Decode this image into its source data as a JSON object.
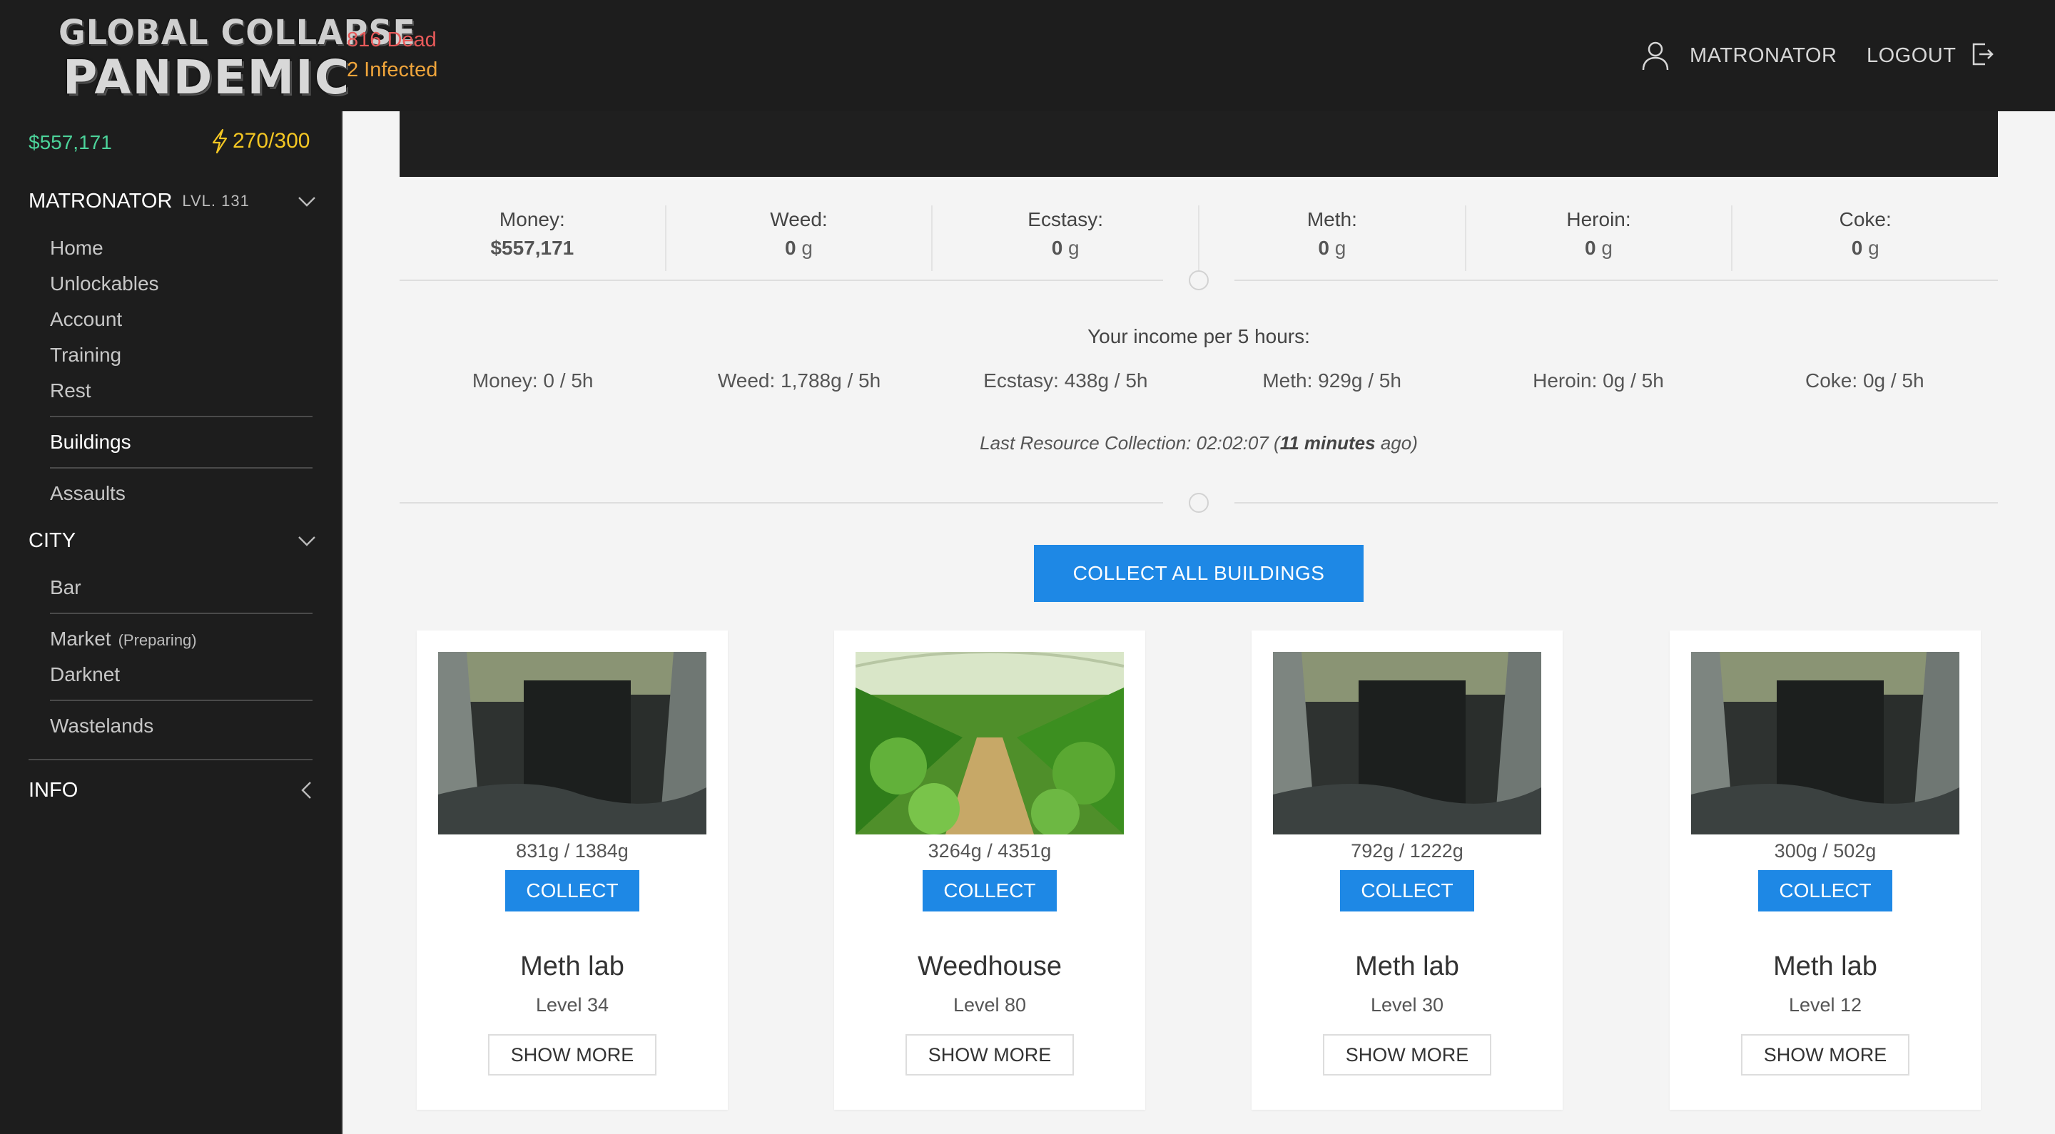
{
  "header": {
    "logo_line1": "GLOBAL COLLAPSE",
    "logo_line2": "PANDEMIC",
    "dead": "816 Dead",
    "infected": "2 Infected",
    "username": "MATRONATOR",
    "logout": "LOGOUT",
    "icons": {
      "user": "user-icon",
      "logout": "logout-icon"
    }
  },
  "sidebar": {
    "money": "$557,171",
    "energy": "270/300",
    "player_section": {
      "name": "MATRONATOR",
      "level": "LVL. 131"
    },
    "player_items": [
      "Home",
      "Unlockables",
      "Account",
      "Training",
      "Rest",
      "Buildings",
      "Assaults"
    ],
    "active_item": "Buildings",
    "city_section": {
      "label": "CITY"
    },
    "city_items": [
      "Bar",
      "Market",
      "Darknet",
      "Wastelands"
    ],
    "market_status": "(Preparing)",
    "info_section": {
      "label": "INFO"
    }
  },
  "resources": [
    {
      "label": "Money:",
      "value": "$557,171",
      "unit": ""
    },
    {
      "label": "Weed:",
      "value": "0",
      "unit": " g"
    },
    {
      "label": "Ecstasy:",
      "value": "0",
      "unit": " g"
    },
    {
      "label": "Meth:",
      "value": "0",
      "unit": " g"
    },
    {
      "label": "Heroin:",
      "value": "0",
      "unit": " g"
    },
    {
      "label": "Coke:",
      "value": "0",
      "unit": " g"
    }
  ],
  "income": {
    "title": "Your income per 5 hours:",
    "items": [
      "Money: 0 / 5h",
      "Weed: 1,788g / 5h",
      "Ecstasy: 438g / 5h",
      "Meth: 929g / 5h",
      "Heroin: 0g / 5h",
      "Coke: 0g / 5h"
    ]
  },
  "last_collection": {
    "prefix": "Last Resource Collection: 02:02:07 (",
    "ago": "11 minutes",
    "suffix": " ago)"
  },
  "collect_all_label": "COLLECT ALL BUILDINGS",
  "buildings": [
    {
      "name": "Meth lab",
      "level": "Level 34",
      "stock": "831g / 1384g",
      "image": "meth-lab-image",
      "collect": "COLLECT",
      "more": "SHOW MORE"
    },
    {
      "name": "Weedhouse",
      "level": "Level 80",
      "stock": "3264g / 4351g",
      "image": "weedhouse-image",
      "collect": "COLLECT",
      "more": "SHOW MORE"
    },
    {
      "name": "Meth lab",
      "level": "Level 30",
      "stock": "792g / 1222g",
      "image": "meth-lab-image",
      "collect": "COLLECT",
      "more": "SHOW MORE"
    },
    {
      "name": "Meth lab",
      "level": "Level 12",
      "stock": "300g / 502g",
      "image": "meth-lab-image",
      "collect": "COLLECT",
      "more": "SHOW MORE"
    }
  ],
  "colors": {
    "accent": "#1e88e5",
    "money": "#4cd39a",
    "energy": "#f3c623",
    "dead": "#e85a5a",
    "infected": "#f0a53b",
    "dark_bg": "#1d1d1d"
  }
}
